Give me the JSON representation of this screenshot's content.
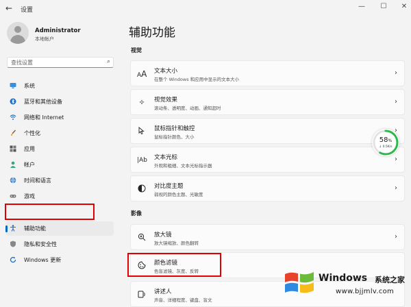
{
  "window": {
    "back": "←",
    "title": "设置",
    "controls": {
      "minimize": "—",
      "maximize": "☐",
      "close": "✕"
    }
  },
  "user": {
    "name": "Administrator",
    "type": "本地帐户"
  },
  "search": {
    "placeholder": "查找设置"
  },
  "nav": [
    {
      "label": "系统",
      "icon": "monitor-icon"
    },
    {
      "label": "蓝牙和其他设备",
      "icon": "bluetooth-icon"
    },
    {
      "label": "网络和 Internet",
      "icon": "network-icon"
    },
    {
      "label": "个性化",
      "icon": "brush-icon"
    },
    {
      "label": "应用",
      "icon": "apps-icon"
    },
    {
      "label": "帐户",
      "icon": "account-icon"
    },
    {
      "label": "时间和语言",
      "icon": "globe-icon"
    },
    {
      "label": "游戏",
      "icon": "gamepad-icon"
    },
    {
      "label": "辅助功能",
      "icon": "accessibility-icon",
      "active": true
    },
    {
      "label": "隐私和安全性",
      "icon": "shield-icon"
    },
    {
      "label": "Windows 更新",
      "icon": "update-icon"
    }
  ],
  "main": {
    "title": "辅助功能",
    "sections": [
      {
        "label": "视觉",
        "items": [
          {
            "title": "文本大小",
            "desc": "在整个 Windows 和应用中显示的文本大小",
            "icon": "text-size-icon"
          },
          {
            "title": "视觉效果",
            "desc": "滚动条、透明度、动画、通知超时",
            "icon": "sparkle-icon"
          },
          {
            "title": "鼠标指针和触控",
            "desc": "鼠标指针颜色、大小",
            "icon": "pointer-icon"
          },
          {
            "title": "文本光标",
            "desc": "外观和粗细、文本光标指示器",
            "icon": "text-cursor-icon"
          },
          {
            "title": "对比度主题",
            "desc": "弱视的颜色主题、光敏度",
            "icon": "contrast-icon"
          }
        ]
      },
      {
        "label": "影像",
        "items": [
          {
            "title": "放大镜",
            "desc": "放大镜缩放、颜色翻转",
            "icon": "magnifier-icon"
          },
          {
            "title": "颜色滤镜",
            "desc": "色盲滤镜、灰度、反转",
            "icon": "color-filter-icon"
          },
          {
            "title": "讲述人",
            "desc": "声音、详细程度、键盘、盲文",
            "icon": "narrator-icon"
          }
        ]
      }
    ]
  },
  "perf_widget": {
    "percent": "58",
    "unit": "%",
    "speed": "↓ 0.5K/s",
    "fraction": 0.58,
    "color": "#2fb84b"
  },
  "watermark": {
    "brand": "Windows",
    "suffix": "系统之家",
    "url": "www.bjjmlv.com"
  },
  "colors": {
    "accent": "#0067c0",
    "highlight_box": "#e00000"
  }
}
